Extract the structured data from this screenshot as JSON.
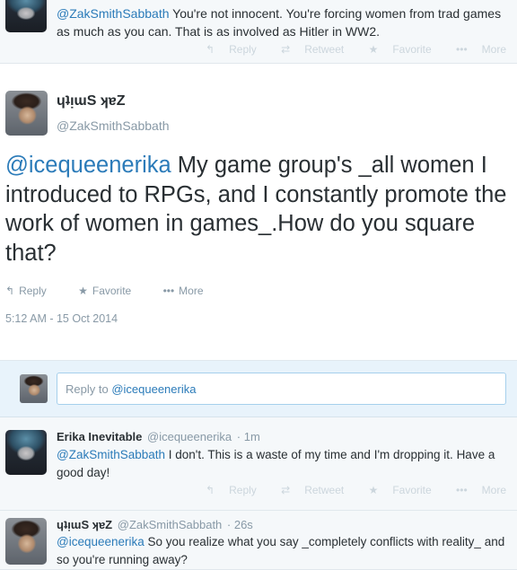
{
  "top_tweet": {
    "mention": "@ZakSmithSabbath",
    "text": " You're not innocent. You're forcing women from trad games as much as you can. That is as involved as Hitler in WW2.",
    "actions": {
      "reply": "Reply",
      "retweet": "Retweet",
      "favorite": "Favorite",
      "more": "More"
    }
  },
  "main_tweet": {
    "name": "ɥʇᴉɯS ʞɐZ",
    "handle": "@ZakSmithSabbath",
    "mention": "@icequeenerika",
    "text": " My game group's _all women I introduced to RPGs, and I constantly promote the work of women in games_.How do you square that?",
    "actions": {
      "reply": "Reply",
      "favorite": "Favorite",
      "more": "More"
    },
    "timestamp": "5:12 AM - 15 Oct 2014"
  },
  "reply_box": {
    "prefix": "Reply to ",
    "mention": "@icequeenerika"
  },
  "replies": [
    {
      "name": "Erika Inevitable",
      "handle": "@icequeenerika",
      "time": "· 1m",
      "mention": "@ZakSmithSabbath",
      "text": " I don't. This is a waste of my time and I'm dropping it. Have a good day!",
      "actions": {
        "reply": "Reply",
        "retweet": "Retweet",
        "favorite": "Favorite",
        "more": "More"
      }
    },
    {
      "name": "ɥʇᴉɯS ʞɐZ",
      "handle": "@ZakSmithSabbath",
      "time": "· 26s",
      "mention": "@icequeenerika",
      "text": " So you realize what you say _completely conflicts with reality_ and so you're running away?"
    }
  ]
}
